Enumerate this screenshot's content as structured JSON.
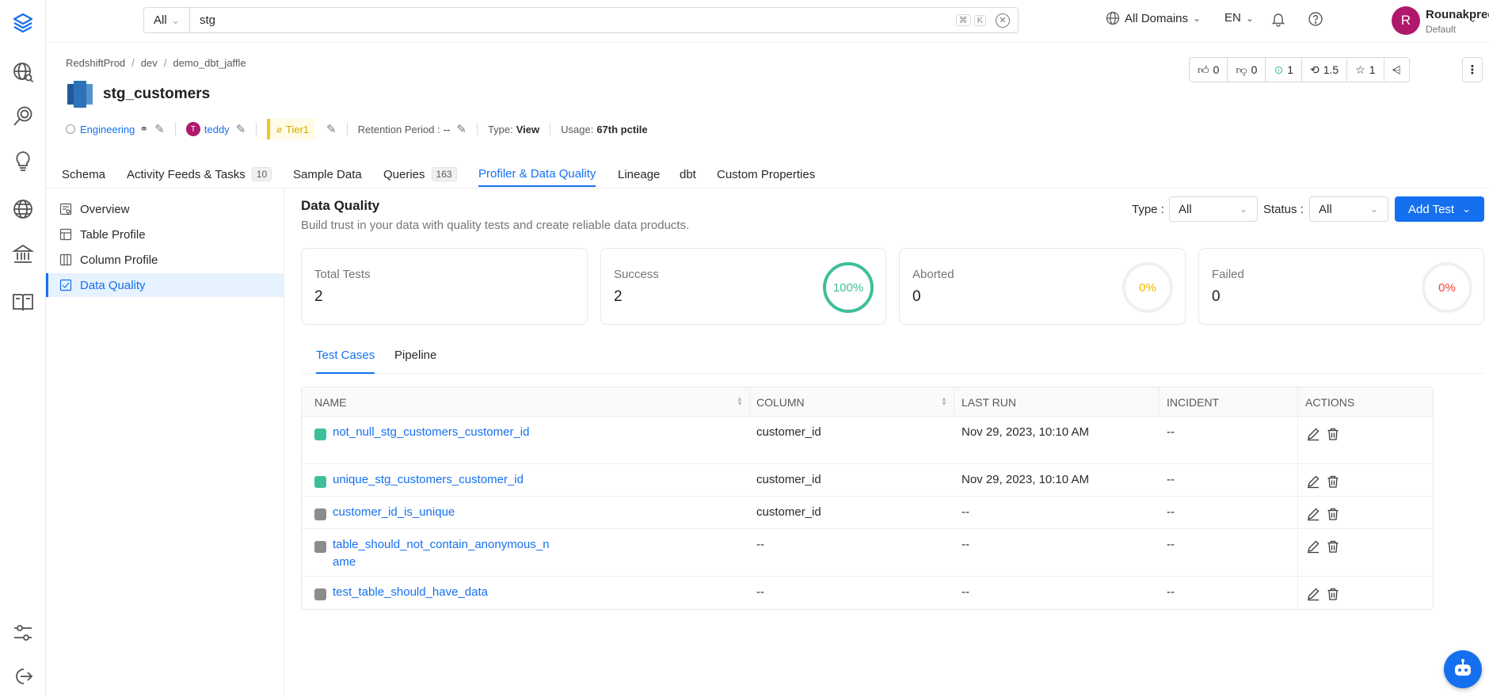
{
  "search": {
    "scope": "All",
    "query": "stg",
    "kbd_cmd": "⌘",
    "kbd_k": "K"
  },
  "topbar": {
    "domains": "All Domains",
    "language": "EN",
    "user_initial": "R",
    "user_name": "Rounakpreet.d",
    "user_role": "Default"
  },
  "breadcrumb": [
    "RedshiftProd",
    "dev",
    "demo_dbt_jaffle"
  ],
  "breadcrumb_sep": "/",
  "entity": {
    "title": "stg_customers",
    "domain": "Engineering",
    "owner_initial": "T",
    "owner": "teddy",
    "tier": "Tier1",
    "retention_label": "Retention Period :",
    "retention_value": "--",
    "type_label": "Type:",
    "type_value": "View",
    "usage_label": "Usage:",
    "usage_value": "67th pctile"
  },
  "entity_actions": {
    "likes": "0",
    "dislikes": "0",
    "tasks": "1",
    "version": "1.5",
    "stars": "1"
  },
  "tabs": [
    {
      "label": "Schema"
    },
    {
      "label": "Activity Feeds & Tasks",
      "count": "10"
    },
    {
      "label": "Sample Data"
    },
    {
      "label": "Queries",
      "count": "163"
    },
    {
      "label": "Profiler & Data Quality",
      "active": true
    },
    {
      "label": "Lineage"
    },
    {
      "label": "dbt"
    },
    {
      "label": "Custom Properties"
    }
  ],
  "sidenav": [
    "Overview",
    "Table Profile",
    "Column Profile",
    "Data Quality"
  ],
  "dq": {
    "title": "Data Quality",
    "subtitle": "Build trust in your data with quality tests and create reliable data products.",
    "type_label": "Type :",
    "type_value": "All",
    "status_label": "Status :",
    "status_value": "All",
    "add_test": "Add Test"
  },
  "summary": [
    {
      "label": "Total Tests",
      "value": "2"
    },
    {
      "label": "Success",
      "value": "2",
      "percent": "100%",
      "color": "#3fbe9a"
    },
    {
      "label": "Aborted",
      "value": "0",
      "percent": "0%",
      "color": "#f5b400"
    },
    {
      "label": "Failed",
      "value": "0",
      "percent": "0%",
      "color": "#f04438"
    }
  ],
  "subtabs": [
    "Test Cases",
    "Pipeline"
  ],
  "table": {
    "headers": [
      "NAME",
      "COLUMN",
      "LAST RUN",
      "INCIDENT",
      "ACTIONS"
    ],
    "rows": [
      {
        "name": "not_null_stg_customers_customer_id",
        "column": "customer_id",
        "last_run": "Nov 29, 2023, 10:10 AM",
        "incident": "--",
        "status_color": "#3fbe9a"
      },
      {
        "name": "unique_stg_customers_customer_id",
        "column": "customer_id",
        "last_run": "Nov 29, 2023, 10:10 AM",
        "incident": "--",
        "status_color": "#3fbe9a"
      },
      {
        "name": "customer_id_is_unique",
        "column": "customer_id",
        "last_run": "--",
        "incident": "--",
        "status_color": "#8c8c8c"
      },
      {
        "name": "table_should_not_contain_anonymous_name",
        "column": "--",
        "last_run": "--",
        "incident": "--",
        "status_color": "#8c8c8c"
      },
      {
        "name": "test_table_should_have_data",
        "column": "--",
        "last_run": "--",
        "incident": "--",
        "status_color": "#8c8c8c"
      }
    ]
  },
  "colors": {
    "accent": "#1570ef",
    "success": "#3fbe9a",
    "aborted": "#f5b400",
    "failed": "#f04438",
    "owner_avatar": "#b0186b"
  },
  "icons": [
    "logo-icon",
    "explore-icon",
    "data-quality-icon",
    "insights-icon",
    "domains-icon",
    "governance-icon",
    "glossary-icon",
    "settings-icon",
    "logout-icon",
    "globe-icon",
    "bell-icon",
    "help-icon",
    "chatbot-icon"
  ]
}
